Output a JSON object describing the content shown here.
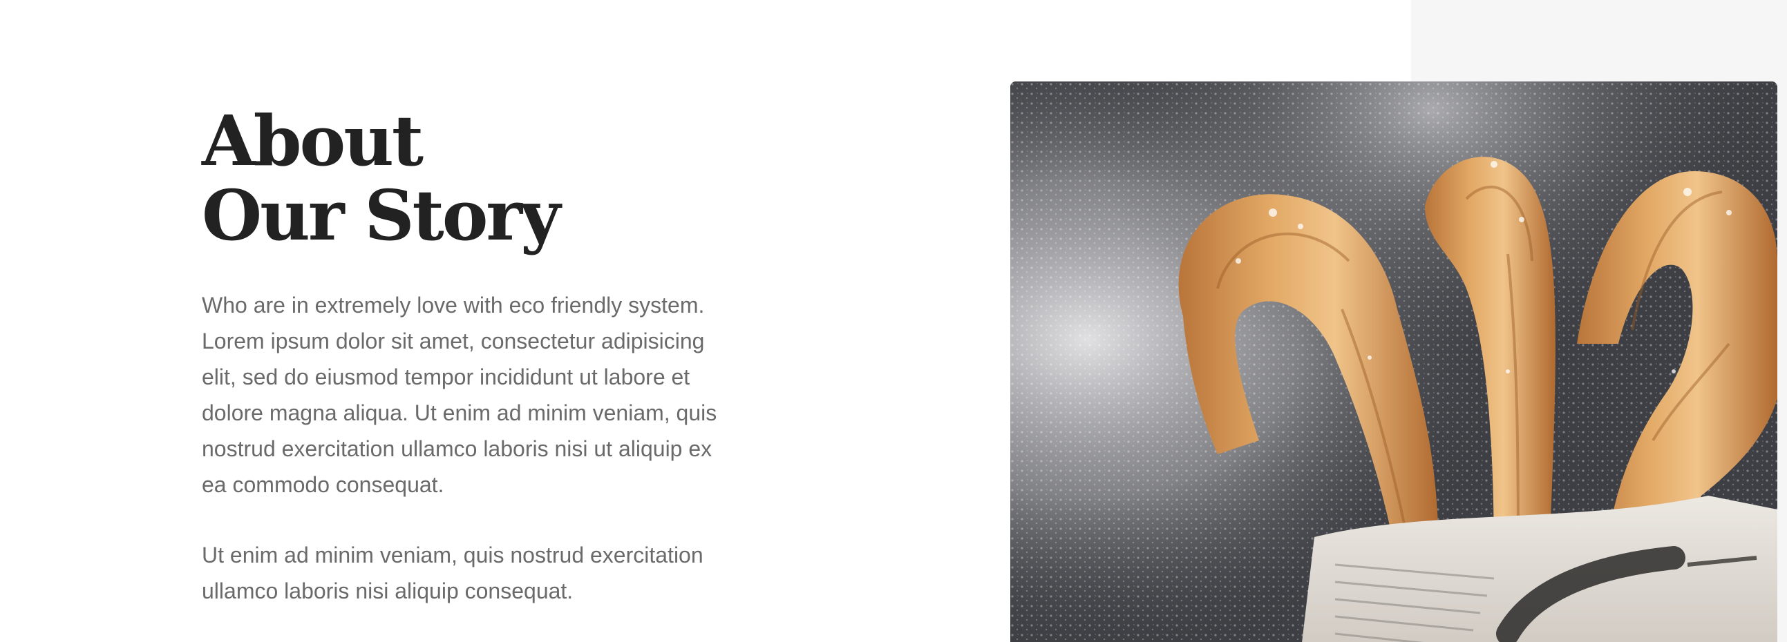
{
  "about": {
    "heading_line1": "About",
    "heading_line2": "Our Story",
    "paragraph1": "Who are in extremely love with eco friendly system. Lorem ipsum dolor sit amet, consectetur adipisicing elit, sed do eiusmod tempor incididunt ut labore et dolore magna aliqua. Ut enim ad minim veniam, quis nostrud exercitation ullamco laboris nisi ut aliquip ex ea commodo consequat.",
    "paragraph2": "Ut enim ad minim veniam, quis nostrud exercitation ullamco laboris nisi aliquip consequat."
  },
  "photo": {
    "subject": "churros-with-powdered-sugar-in-newspaper"
  },
  "colors": {
    "heading": "#222222",
    "body_text": "#6a6a6a",
    "right_panel": "#f6f6f6",
    "photo_background": "#3e3f44"
  }
}
